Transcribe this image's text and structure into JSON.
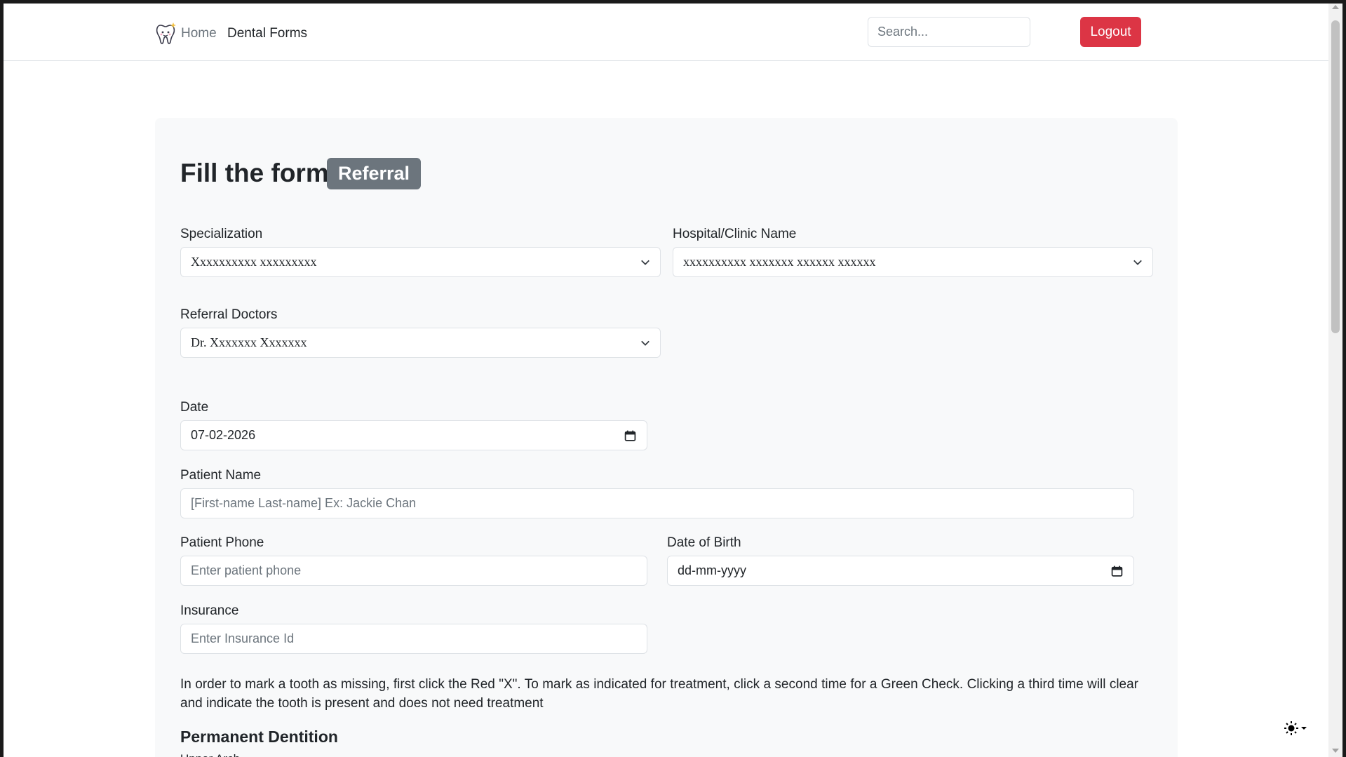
{
  "nav": {
    "logo_icon": "tooth-icon",
    "home_label": "Home",
    "forms_label": "Dental Forms",
    "search_placeholder": "Search...",
    "logout_label": "Logout"
  },
  "form": {
    "title": "Fill the form",
    "badge": "Referral",
    "specialization": {
      "label": "Specialization",
      "value": "Xxxxxxxxxx xxxxxxxxx"
    },
    "hospital": {
      "label": "Hospital/Clinic Name",
      "value": "xxxxxxxxxx xxxxxxx xxxxxx xxxxxx"
    },
    "referral_doctors": {
      "label": "Referral Doctors",
      "value": "Dr. Xxxxxxx Xxxxxxx"
    },
    "date": {
      "label": "Date",
      "value": "07-02-2026"
    },
    "patient_name": {
      "label": "Patient Name",
      "placeholder": "[First-name Last-name] Ex: Jackie Chan"
    },
    "patient_phone": {
      "label": "Patient Phone",
      "placeholder": "Enter patient phone"
    },
    "dob": {
      "label": "Date of Birth",
      "value": "dd-mm-yyyy"
    },
    "insurance": {
      "label": "Insurance",
      "placeholder": "Enter Insurance Id"
    },
    "instructions": "In order to mark a tooth as missing, first click the Red \"X\". To mark as indicated for treatment, click a second time for a Green Check. Clicking a third time will clear and indicate the tooth is present and does not need treatment",
    "section_title": "Permanent Dentition",
    "next_label_partial": "Upper Arch"
  },
  "theme_toggle": {
    "icon": "sun-icon"
  },
  "colors": {
    "danger": "#dc3545",
    "secondary": "#6c757d",
    "card_bg": "#f8f9fa",
    "border": "#dee2e6"
  }
}
